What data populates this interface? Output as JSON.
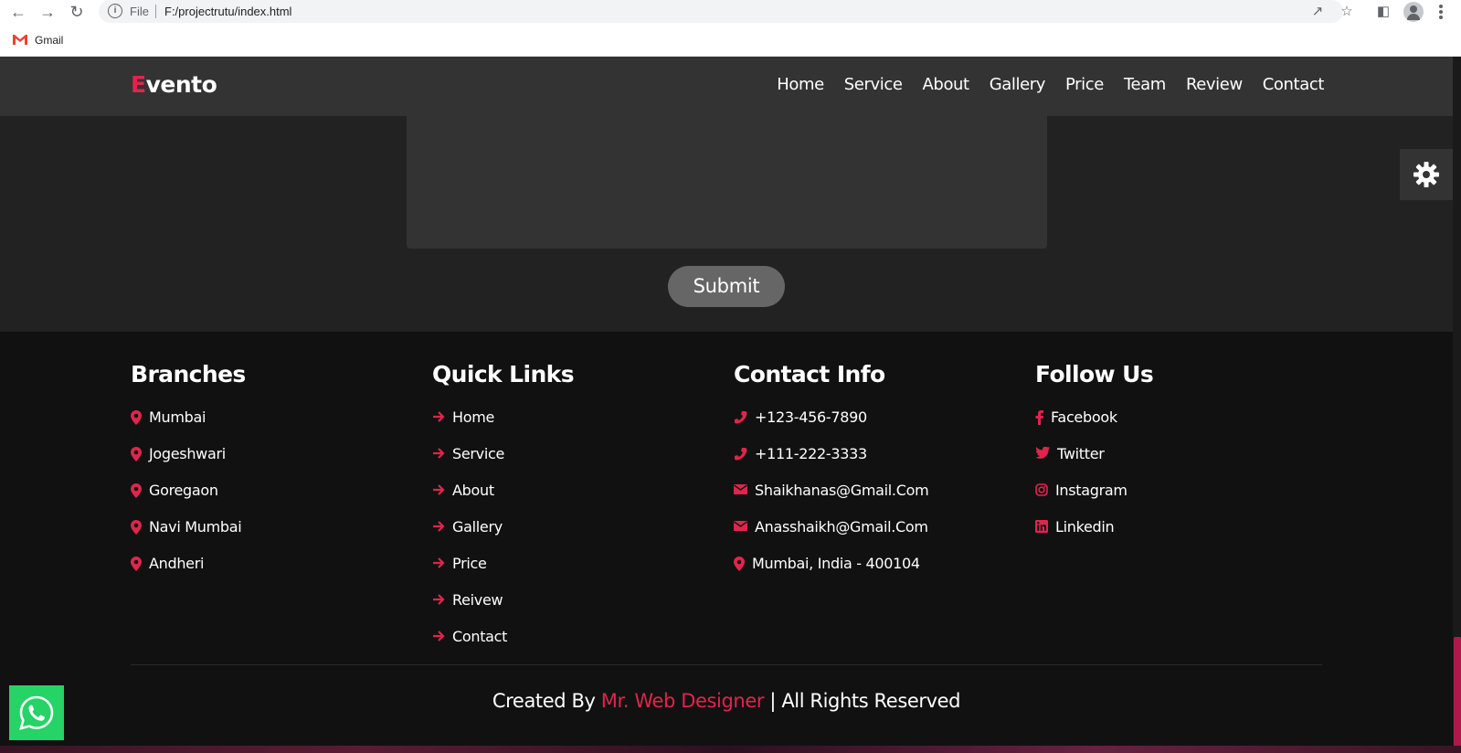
{
  "browser": {
    "url_scheme_label": "File",
    "url": "F:/projectrutu/index.html",
    "bookmark_label": "Gmail"
  },
  "site": {
    "logo_first": "E",
    "logo_rest": "vento",
    "nav": [
      "Home",
      "Service",
      "About",
      "Gallery",
      "Price",
      "Team",
      "Review",
      "Contact"
    ]
  },
  "form": {
    "submit_label": "Submit"
  },
  "footer": {
    "branches": {
      "title": "Branches",
      "items": [
        "Mumbai",
        "Jogeshwari",
        "Goregaon",
        "Navi Mumbai",
        "Andheri"
      ]
    },
    "quick_links": {
      "title": "Quick Links",
      "items": [
        "Home",
        "Service",
        "About",
        "Gallery",
        "Price",
        "Reivew",
        "Contact"
      ]
    },
    "contact": {
      "title": "Contact Info",
      "items": [
        {
          "icon": "phone-icon",
          "text": "+123-456-7890"
        },
        {
          "icon": "phone-icon",
          "text": "+111-222-3333"
        },
        {
          "icon": "envelope-icon",
          "text": "Shaikhanas@Gmail.Com"
        },
        {
          "icon": "envelope-icon",
          "text": "Anasshaikh@Gmail.Com"
        },
        {
          "icon": "map-marker-icon",
          "text": "Mumbai, India - 400104"
        }
      ]
    },
    "follow": {
      "title": "Follow Us",
      "items": [
        {
          "icon": "facebook-icon",
          "text": "Facebook"
        },
        {
          "icon": "twitter-icon",
          "text": "Twitter"
        },
        {
          "icon": "instagram-icon",
          "text": "Instagram"
        },
        {
          "icon": "linkedin-icon",
          "text": "Linkedin"
        }
      ]
    },
    "credit_prefix": "Created By",
    "credit_name": "Mr. Web Designer",
    "credit_suffix": "| All Rights Reserved"
  },
  "colors": {
    "accent": "#e0254c",
    "header_bg": "#333333",
    "footer_bg": "#111111",
    "whatsapp": "#25d366"
  }
}
